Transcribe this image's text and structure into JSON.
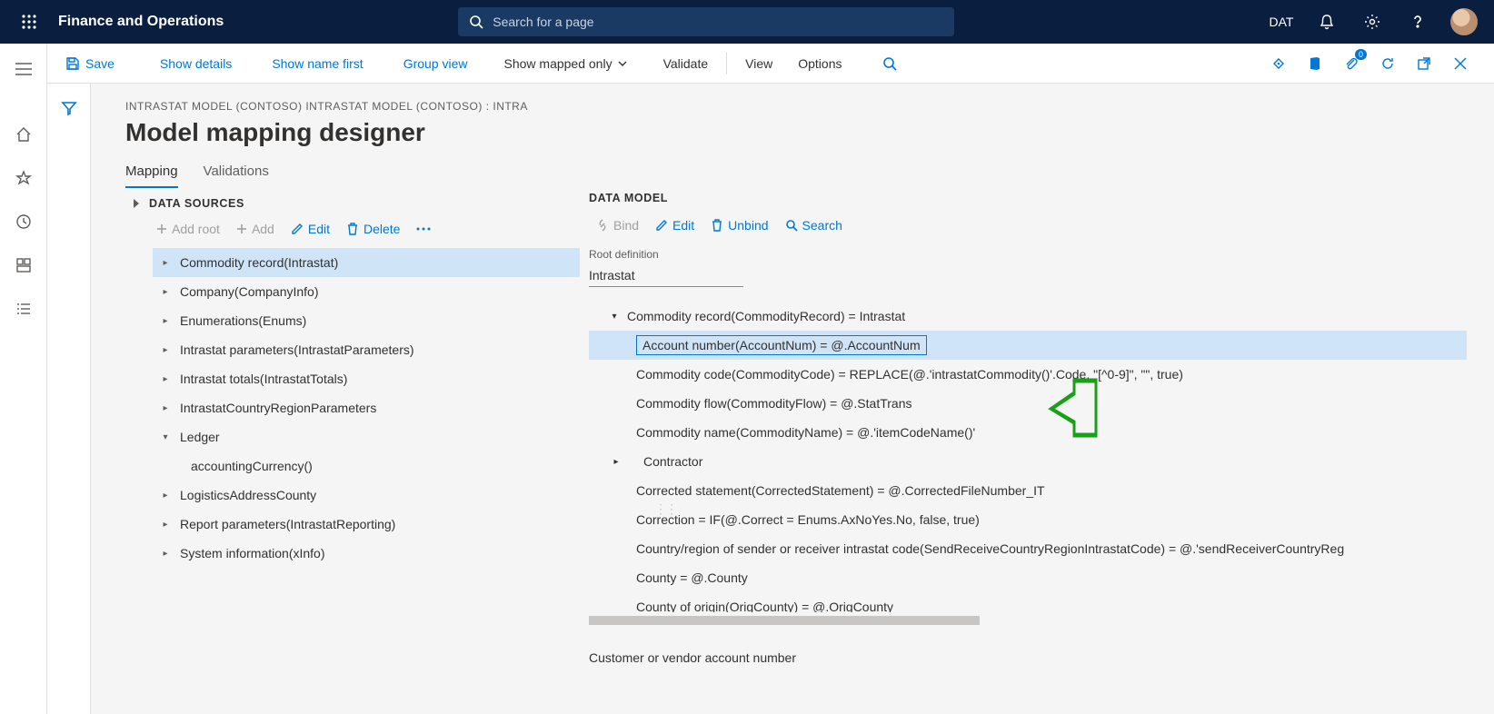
{
  "app": {
    "title": "Finance and Operations"
  },
  "search": {
    "placeholder": "Search for a page"
  },
  "nav": {
    "company": "DAT"
  },
  "commands": {
    "save": "Save",
    "show_details": "Show details",
    "show_name_first": "Show name first",
    "group_view": "Group view",
    "show_mapped_only": "Show mapped only",
    "validate": "Validate",
    "view": "View",
    "options": "Options",
    "badge_count": "0"
  },
  "breadcrumb": "INTRASTAT MODEL (CONTOSO) INTRASTAT MODEL (CONTOSO) : INTRA",
  "page_title": "Model mapping designer",
  "tabs": {
    "mapping": "Mapping",
    "validations": "Validations"
  },
  "ds": {
    "title": "DATA SOURCES",
    "add_root": "Add root",
    "add": "Add",
    "edit": "Edit",
    "delete": "Delete",
    "items": [
      {
        "label": "Commodity record(Intrastat)",
        "selected": true
      },
      {
        "label": "Company(CompanyInfo)"
      },
      {
        "label": "Enumerations(Enums)"
      },
      {
        "label": "Intrastat parameters(IntrastatParameters)"
      },
      {
        "label": "Intrastat totals(IntrastatTotals)"
      },
      {
        "label": "IntrastatCountryRegionParameters"
      },
      {
        "label": "Ledger",
        "expanded": true,
        "children": [
          {
            "label": "accountingCurrency()"
          }
        ]
      },
      {
        "label": "LogisticsAddressCounty"
      },
      {
        "label": "Report parameters(IntrastatReporting)"
      },
      {
        "label": "System information(xInfo)"
      }
    ]
  },
  "dm": {
    "title": "DATA MODEL",
    "bind": "Bind",
    "edit": "Edit",
    "unbind": "Unbind",
    "search": "Search",
    "root_label": "Root definition",
    "root_value": "Intrastat",
    "root_item": "Commodity record(CommodityRecord) = Intrastat",
    "items": [
      "Account number(AccountNum) = @.AccountNum",
      "Commodity code(CommodityCode) = REPLACE(@.'intrastatCommodity()'.Code, \"[^0-9]\", \"\", true)",
      "Commodity flow(CommodityFlow) = @.StatTrans",
      "Commodity name(CommodityName) = @.'itemCodeName()'",
      "Contractor",
      "Corrected statement(CorrectedStatement) = @.CorrectedFileNumber_IT",
      "Correction = IF(@.Correct = Enums.AxNoYes.No, false, true)",
      "Country/region of sender or receiver intrastat code(SendReceiveCountryRegionIntrastatCode) = @.'sendReceiverCountryReg",
      "County = @.County",
      "County of origin(OrigCounty) = @.OrigCounty"
    ],
    "footer": "Customer or vendor account number"
  }
}
